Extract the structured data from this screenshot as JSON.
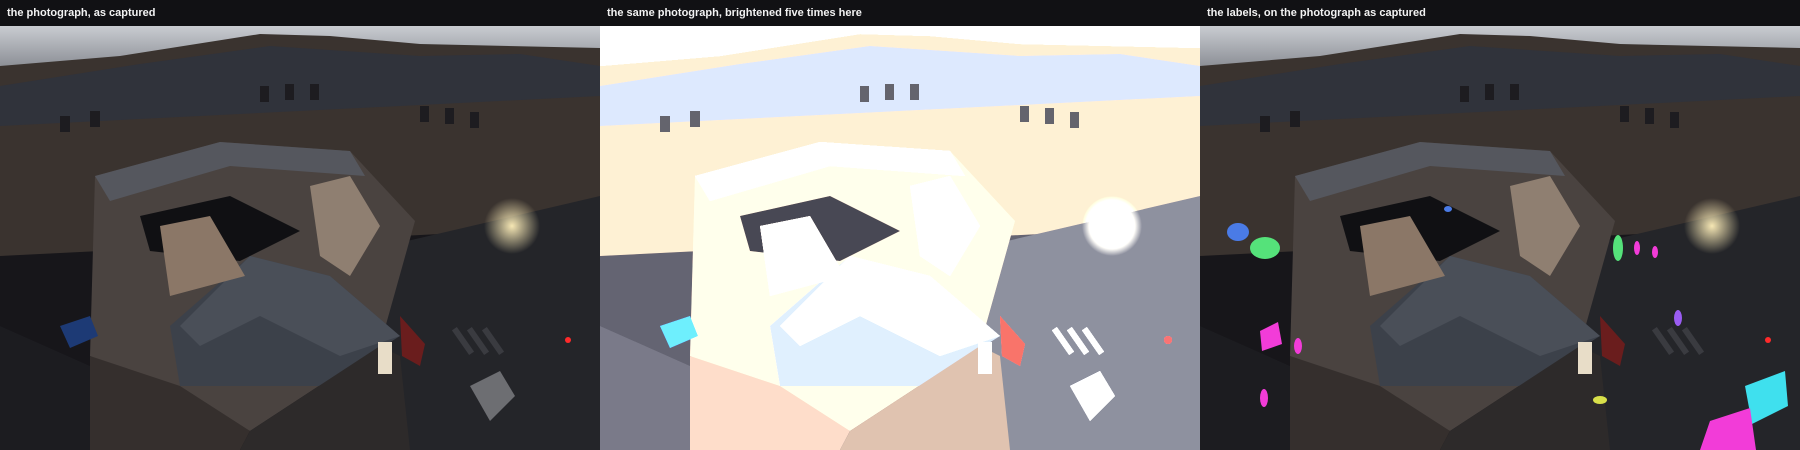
{
  "panels": [
    {
      "caption": "the photograph, as captured",
      "variant": "dark"
    },
    {
      "caption": "the same photograph, brightened five times here",
      "variant": "brightened"
    },
    {
      "caption": "the labels, on the photograph as captured",
      "variant": "labels"
    }
  ],
  "colors": {
    "caption_bg": "#111114",
    "caption_text": "#f2f2f2",
    "label_blue": "#4a7be6",
    "label_green": "#55e27a",
    "label_magenta": "#f23cd8",
    "label_cyan": "#3fe0ee",
    "label_violet": "#9a5cf2"
  }
}
